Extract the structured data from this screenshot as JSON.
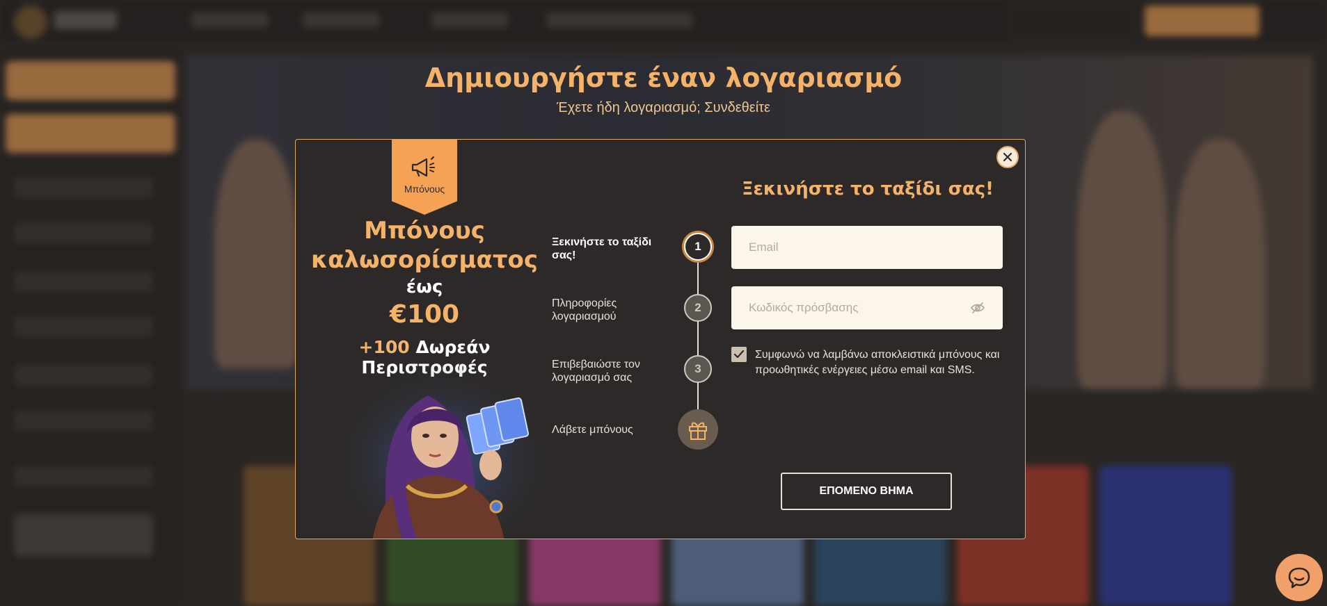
{
  "page": {
    "title": "Δημιουργήστε έναν λογαριασμό",
    "subtitle": "Έχετε ήδη λογαριασμό; Συνδεθείτε"
  },
  "modal": {
    "bonus_tab_label": "Μπόνους",
    "promo": {
      "line1": "Μπόνους",
      "line2": "καλωσορίσματος",
      "upto": "έως",
      "amount": "€100",
      "spins_number": "+100",
      "spins_text": "Δωρεάν Περιστροφές"
    },
    "steps": [
      {
        "number": "1",
        "label": "Ξεκινήστε το ταξίδι σας!"
      },
      {
        "number": "2",
        "label": "Πληροφορίες λογαριασμού"
      },
      {
        "number": "3",
        "label": "Επιβεβαιώστε τον λογαριασμό σας"
      },
      {
        "number": "",
        "label": "Λάβετε μπόνους"
      }
    ],
    "form": {
      "title": "Ξεκινήστε το ταξίδι σας!",
      "email_placeholder": "Email",
      "password_placeholder": "Κωδικός πρόσβασης",
      "consent_text": "Συμφωνώ να λαμβάνω αποκλειστικά μπόνους και προωθητικές ενέργειες μέσω email και SMS.",
      "consent_checked": true,
      "next_button": "ΕΠΟΜΕΝΟ ΒΗΜΑ"
    }
  },
  "icons": {
    "close": "close-icon",
    "megaphone": "megaphone-icon",
    "eye": "eye-off-icon",
    "check": "checkmark-icon",
    "gift": "gift-icon",
    "chat": "chat-icon"
  },
  "colors": {
    "accent": "#f5a254",
    "title_gold": "#f5b36a",
    "modal_bg": "#2d2928",
    "field_bg": "#fbf5ec"
  }
}
